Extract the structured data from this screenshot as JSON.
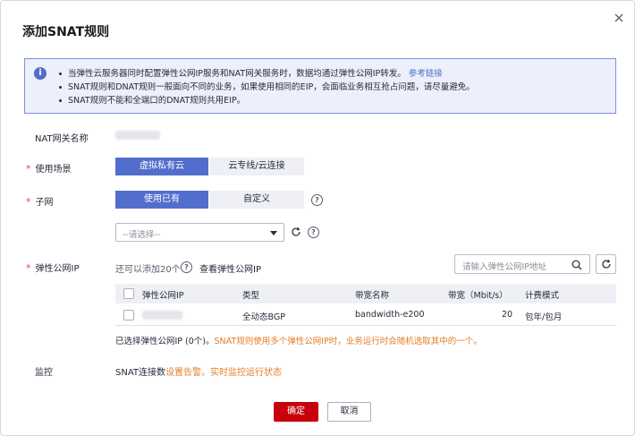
{
  "dialog": {
    "title": "添加SNAT规则",
    "close_icon": "close-icon"
  },
  "notice": {
    "icon": "info-icon",
    "line1_text": "当弹性云服务器同时配置弹性公网IP服务和NAT网关服务时，数据均通过弹性公网IP转发。",
    "line1_link": "参考链接",
    "line2": "SNAT规则和DNAT规则一般面向不同的业务，如果使用相同的EIP，会面临业务相互抢占问题，请尽量避免。",
    "line3": "SNAT规则不能和全端口的DNAT规则共用EIP。"
  },
  "form": {
    "nat_name_label": "NAT网关名称",
    "scenario_label": "使用场景",
    "scenario_options": [
      "虚拟私有云",
      "云专线/云连接"
    ],
    "scenario_selected": "虚拟私有云",
    "subnet_label": "子网",
    "subnet_options": [
      "使用已有",
      "自定义"
    ],
    "subnet_selected": "使用已有",
    "subnet_select_value": "--请选择--",
    "eip_label": "弹性公网IP",
    "eip_quota": "还可以添加20个",
    "eip_view_link": "查看弹性公网IP",
    "eip_search_placeholder": "请输入弹性公网IP地址",
    "monitor_label": "监控",
    "monitor_text": "SNAT连接数",
    "monitor_link1": "设置告警",
    "monitor_sep": "。",
    "monitor_link2": "实时监控运行状态"
  },
  "table": {
    "columns": [
      "弹性公网IP",
      "类型",
      "带宽名称",
      "带宽（Mbit/s）",
      "计费模式"
    ],
    "rows": [
      {
        "type": "全动态BGP",
        "bandwidth_name": "bandwidth-e200",
        "bandwidth": "20",
        "billing": "包年/包月"
      }
    ]
  },
  "selection": {
    "text": "已选择弹性公网IP (0个)。",
    "warning": "SNAT规则使用多个弹性公网IP时，业务运行时会随机选取其中的一个。"
  },
  "footer": {
    "ok_label": "确定",
    "cancel_label": "取消"
  },
  "colors": {
    "primary": "#526ecc",
    "danger": "#c7000b",
    "warning": "#e37d29",
    "required": "#e54545"
  }
}
